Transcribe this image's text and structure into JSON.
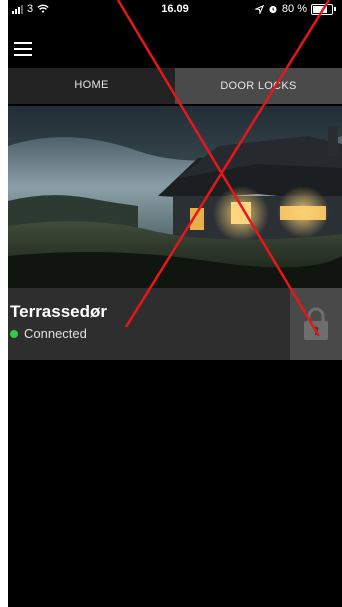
{
  "status_bar": {
    "carrier": "3",
    "time": "16.09",
    "battery": "80 %"
  },
  "menu": {
    "icon": "hamburger-menu-icon"
  },
  "tabs": [
    {
      "label": "HOME",
      "active": false
    },
    {
      "label": "DOOR LOCKS",
      "active": true
    }
  ],
  "lock": {
    "name": "Terrassedør",
    "status": "Connected",
    "status_color": "#2ecc40",
    "icon": "padlock-icon"
  },
  "colors": {
    "background": "#000000",
    "active_tab": "#4a4a4a",
    "inactive_tab": "#222222",
    "card": "#2e2e2e",
    "overlay_cross": "#e8161b"
  }
}
